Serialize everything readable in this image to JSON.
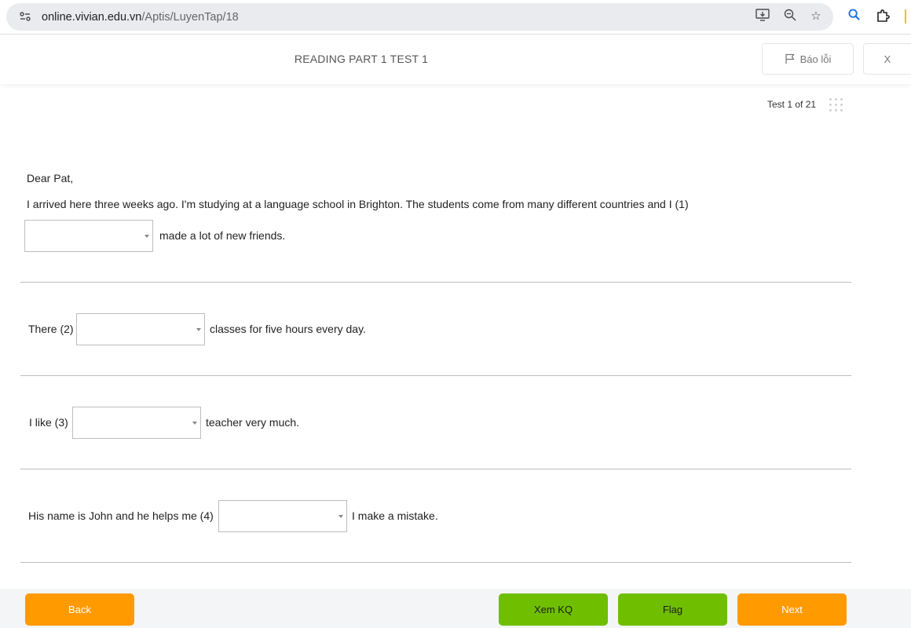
{
  "browser": {
    "url_host": "online.vivian.edu.vn",
    "url_path": "/Aptis/LuyenTap/18",
    "icons": [
      "site-settings-icon",
      "install-app-icon",
      "zoom-icon",
      "bookmark-star-icon",
      "extension-search-icon",
      "extensions-puzzle-icon"
    ]
  },
  "header": {
    "title": "READING PART 1 TEST 1",
    "report_label": "Báo lỗi",
    "close_label": "X"
  },
  "progress": {
    "label": "Test 1 of 21"
  },
  "passage": {
    "greeting": "Dear Pat,",
    "intro": "I arrived here three weeks ago. I'm studying at a language school  in  Brighton. The students come from many different countries and I (1)",
    "q1_after": "made a lot of new friends.",
    "q2_before": "There (2)",
    "q2_after": "classes for five hours every day.",
    "q3_before": "I like (3)",
    "q3_after": "teacher very much.",
    "q4_before": "His name is John and he helps me (4)",
    "q4_after": "I make a mistake."
  },
  "answers": {
    "q1": "",
    "q2": "",
    "q3": "",
    "q4": ""
  },
  "footer": {
    "back_label": "Back",
    "result_label": "Xem KQ",
    "flag_label": "Flag",
    "next_label": "Next"
  },
  "colors": {
    "orange": "#ff9a00",
    "green": "#6fbf00"
  }
}
